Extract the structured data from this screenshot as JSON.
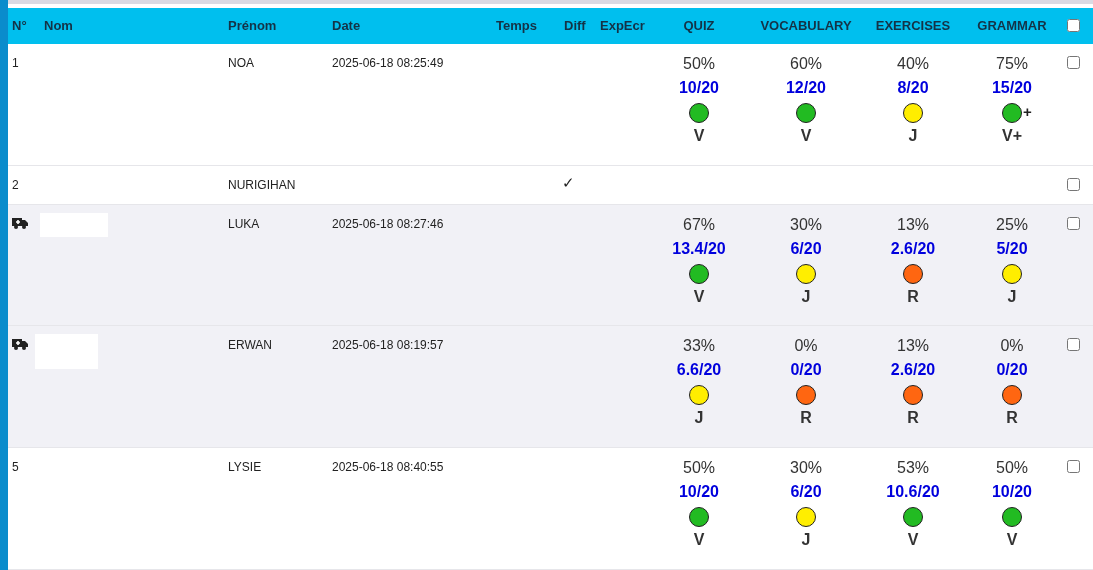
{
  "table": {
    "columns": [
      "N°",
      "Nom",
      "Prénom",
      "Date",
      "Temps",
      "Diff",
      "ExpEcr",
      "QUIZ",
      "VOCABULARY",
      "EXERCISES",
      "GRAMMAR"
    ],
    "select_all": {
      "checked": false
    },
    "rows": [
      {
        "number": "1",
        "kind": "numbered",
        "prenom": "NOA",
        "date": "2025-06-18 08:25:49",
        "shaded": false,
        "checked": false,
        "scores": [
          {
            "percent": "50%",
            "score": "10/20",
            "color": "#22bb22",
            "grade": "V"
          },
          {
            "percent": "60%",
            "score": "12/20",
            "color": "#22bb22",
            "grade": "V"
          },
          {
            "percent": "40%",
            "score": "8/20",
            "color": "#ffee00",
            "grade": "J"
          },
          {
            "percent": "75%",
            "score": "15/20",
            "color": "#22bb22",
            "suffix": "+",
            "grade": "V+"
          }
        ]
      },
      {
        "number": "2",
        "kind": "numbered",
        "prenom": "NURIGIHAN",
        "diff": "✓",
        "shaded": false,
        "checked": false
      },
      {
        "kind": "ambulance",
        "nom_hidden": true,
        "prenom": "LUKA",
        "date": "2025-06-18 08:27:46",
        "shaded": true,
        "checked": false,
        "scores": [
          {
            "percent": "67%",
            "score": "13.4/20",
            "color": "#22bb22",
            "grade": "V"
          },
          {
            "percent": "30%",
            "score": "6/20",
            "color": "#ffee00",
            "grade": "J"
          },
          {
            "percent": "13%",
            "score": "2.6/20",
            "color": "#ff6611",
            "grade": "R"
          },
          {
            "percent": "25%",
            "score": "5/20",
            "color": "#ffee00",
            "grade": "J"
          }
        ]
      },
      {
        "kind": "ambulance",
        "nom_hidden": true,
        "prenom": "ERWAN",
        "date": "2025-06-18 08:19:57",
        "shaded": true,
        "checked": false,
        "scores": [
          {
            "percent": "33%",
            "score": "6.6/20",
            "color": "#ffee00",
            "grade": "J"
          },
          {
            "percent": "0%",
            "score": "0/20",
            "color": "#ff6611",
            "grade": "R"
          },
          {
            "percent": "13%",
            "score": "2.6/20",
            "color": "#ff6611",
            "grade": "R"
          },
          {
            "percent": "0%",
            "score": "0/20",
            "color": "#ff6611",
            "grade": "R"
          }
        ]
      },
      {
        "number": "5",
        "kind": "numbered",
        "prenom": "LYSIE",
        "date": "2025-06-18 08:40:55",
        "shaded": false,
        "checked": false,
        "scores": [
          {
            "percent": "50%",
            "score": "10/20",
            "color": "#22bb22",
            "grade": "V"
          },
          {
            "percent": "30%",
            "score": "6/20",
            "color": "#ffee00",
            "grade": "J"
          },
          {
            "percent": "53%",
            "score": "10.6/20",
            "color": "#22bb22",
            "grade": "V"
          },
          {
            "percent": "50%",
            "score": "10/20",
            "color": "#22bb22",
            "grade": "V"
          }
        ]
      }
    ]
  }
}
